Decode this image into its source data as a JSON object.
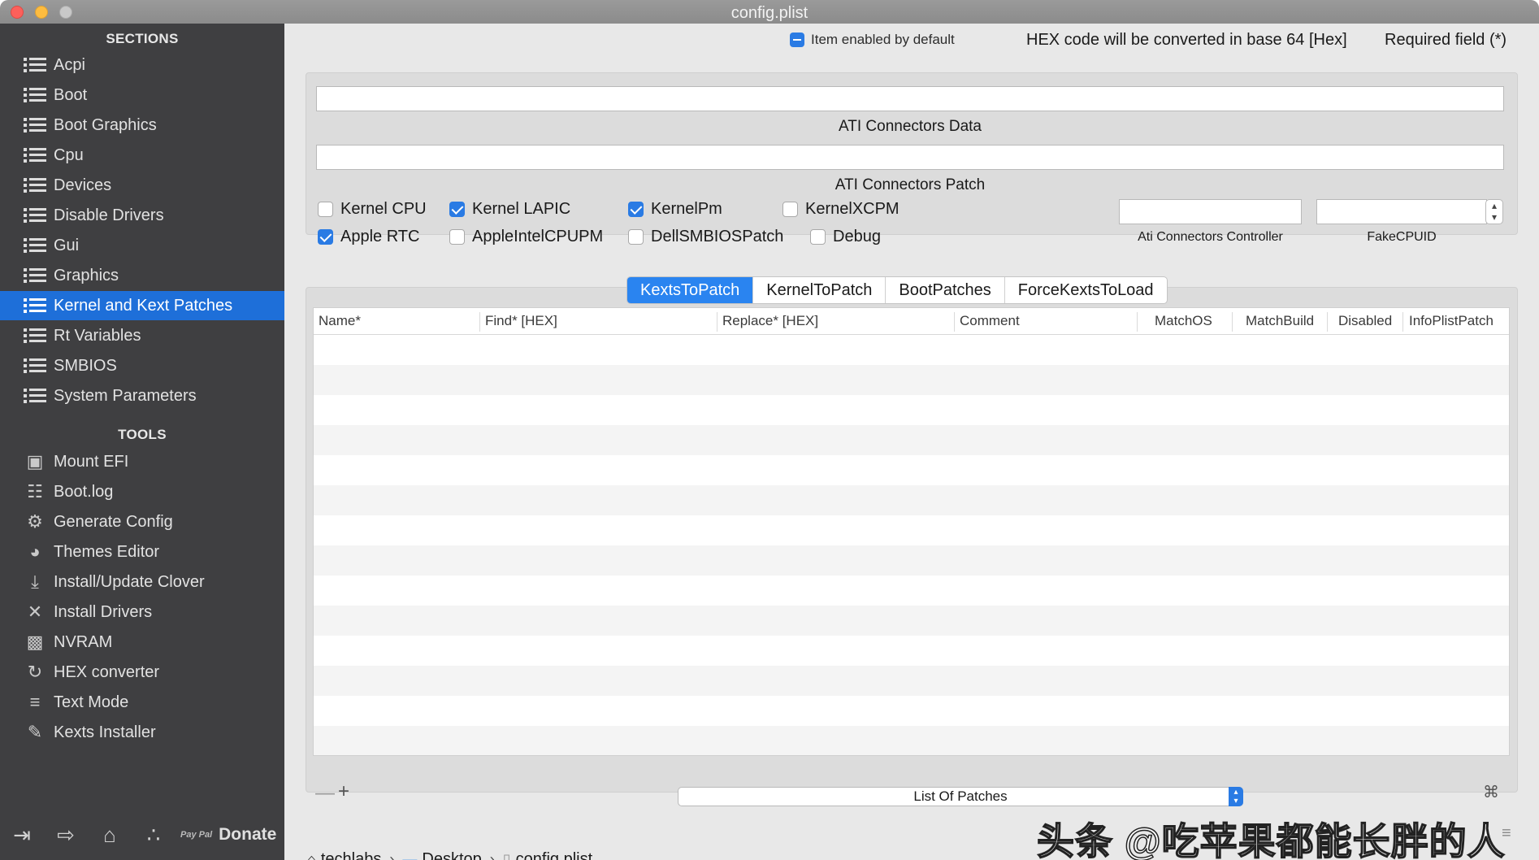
{
  "window": {
    "title": "config.plist"
  },
  "sidebar": {
    "sections_header": "SECTIONS",
    "sections": [
      {
        "label": "Acpi"
      },
      {
        "label": "Boot"
      },
      {
        "label": "Boot Graphics"
      },
      {
        "label": "Cpu"
      },
      {
        "label": "Devices"
      },
      {
        "label": "Disable Drivers"
      },
      {
        "label": "Gui"
      },
      {
        "label": "Graphics"
      },
      {
        "label": "Kernel and Kext Patches"
      },
      {
        "label": "Rt Variables"
      },
      {
        "label": "SMBIOS"
      },
      {
        "label": "System Parameters"
      }
    ],
    "active_section": "Kernel and Kext Patches",
    "tools_header": "TOOLS",
    "tools": [
      {
        "label": "Mount EFI",
        "icon": "disk-icon"
      },
      {
        "label": "Boot.log",
        "icon": "log-search-icon"
      },
      {
        "label": "Generate Config",
        "icon": "gears-icon"
      },
      {
        "label": "Themes Editor",
        "icon": "palette-icon"
      },
      {
        "label": "Install/Update Clover",
        "icon": "download-icon"
      },
      {
        "label": "Install Drivers",
        "icon": "tools-icon"
      },
      {
        "label": "NVRAM",
        "icon": "chip-icon"
      },
      {
        "label": "HEX converter",
        "icon": "refresh-icon"
      },
      {
        "label": "Text Mode",
        "icon": "text-lines-icon"
      },
      {
        "label": "Kexts Installer",
        "icon": "brush-icon"
      }
    ],
    "bottom": {
      "donate_label": "Donate",
      "paypal_label": "Pay Pal"
    }
  },
  "header": {
    "item_enabled_label": "Item enabled by default",
    "hex_note": "HEX code will be converted in base 64 [Hex]",
    "required_note": "Required field (*)"
  },
  "kernel_panel": {
    "ati_connectors_data_label": "ATI Connectors Data",
    "ati_connectors_data_value": "",
    "ati_connectors_patch_label": "ATI Connectors Patch",
    "ati_connectors_patch_value": "",
    "checkboxes": [
      {
        "label": "Kernel CPU",
        "checked": false
      },
      {
        "label": "Kernel LAPIC",
        "checked": true
      },
      {
        "label": "KernelPm",
        "checked": true
      },
      {
        "label": "KernelXCPM",
        "checked": false
      },
      {
        "label": "Apple RTC",
        "checked": true
      },
      {
        "label": "AppleIntelCPUPM",
        "checked": false
      },
      {
        "label": "DellSMBIOSPatch",
        "checked": false
      },
      {
        "label": "Debug",
        "checked": false
      }
    ],
    "ati_controller_label": "Ati Connectors Controller",
    "ati_controller_value": "",
    "fake_cpuid_label": "FakeCPUID",
    "fake_cpuid_value": ""
  },
  "tabs": [
    {
      "label": "KextsToPatch",
      "active": true
    },
    {
      "label": "KernelToPatch",
      "active": false
    },
    {
      "label": "BootPatches",
      "active": false
    },
    {
      "label": "ForceKextsToLoad",
      "active": false
    }
  ],
  "table": {
    "columns": [
      "Name*",
      "Find* [HEX]",
      "Replace* [HEX]",
      "Comment",
      "MatchOS",
      "MatchBuild",
      "Disabled",
      "InfoPlistPatch"
    ],
    "rows": []
  },
  "table_footer": {
    "remove_label": "—",
    "add_label": "+",
    "patch_list_value": "List Of Patches"
  },
  "pathbar": {
    "segments": [
      {
        "label": "techlabs",
        "icon": "home-icon"
      },
      {
        "label": "Desktop",
        "icon": "folder-icon"
      },
      {
        "label": "config.plist",
        "icon": "file-icon"
      }
    ],
    "separator": "›"
  },
  "watermark": "头条 @吃苹果都能长胖的人",
  "colors": {
    "accent": "#2a7be4",
    "sidebar_bg": "#3f3f41",
    "active_item": "#1e6fd9"
  }
}
